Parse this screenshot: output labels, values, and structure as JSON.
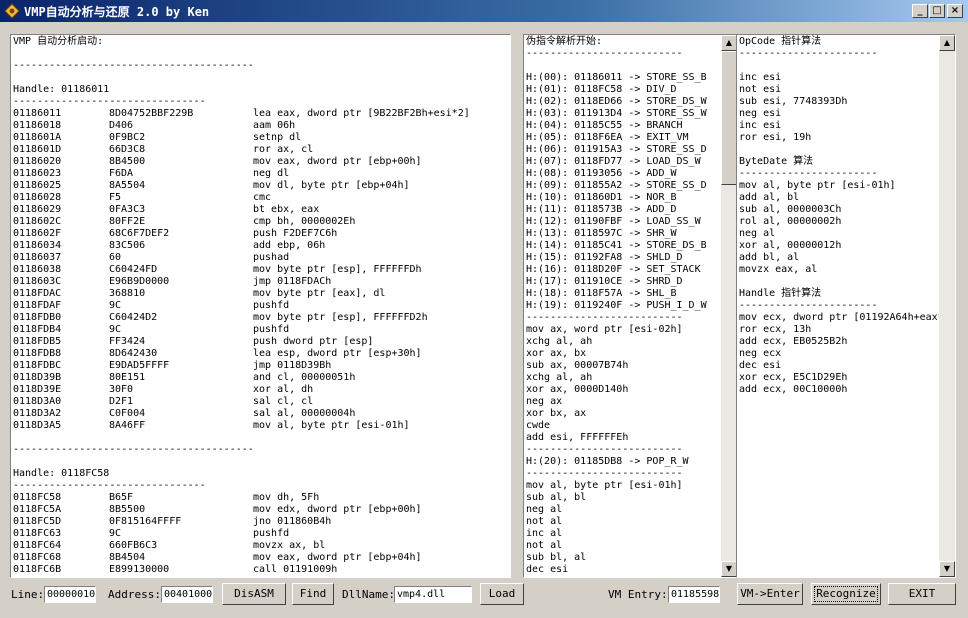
{
  "window": {
    "title": "VMP自动分析与还原 2.0 by Ken",
    "controls": {
      "minimize": "_",
      "maximize": "□",
      "close": "×"
    }
  },
  "left_pane": {
    "lines": [
      [
        "VMP 自动分析启动:"
      ],
      [
        ""
      ],
      [
        "----------------------------------------"
      ],
      [
        ""
      ],
      [
        "Handle: 01186011"
      ],
      [
        "--------------------------------"
      ],
      [
        "01186011",
        "8D04752BBF229B",
        "lea eax, dword ptr [9B22BF2Bh+esi*2]"
      ],
      [
        "01186018",
        "D406",
        "aam 06h"
      ],
      [
        "0118601A",
        "0F9BC2",
        "setnp dl"
      ],
      [
        "0118601D",
        "66D3C8",
        "ror ax, cl"
      ],
      [
        "01186020",
        "8B4500",
        "mov eax, dword ptr [ebp+00h]"
      ],
      [
        "01186023",
        "F6DA",
        "neg dl"
      ],
      [
        "01186025",
        "8A5504",
        "mov dl, byte ptr [ebp+04h]"
      ],
      [
        "01186028",
        "F5",
        "cmc"
      ],
      [
        "01186029",
        "0FA3C3",
        "bt ebx, eax"
      ],
      [
        "0118602C",
        "80FF2E",
        "cmp bh, 0000002Eh"
      ],
      [
        "0118602F",
        "68C6F7DEF2",
        "push F2DEF7C6h"
      ],
      [
        "01186034",
        "83C506",
        "add ebp, 06h"
      ],
      [
        "01186037",
        "60",
        "pushad"
      ],
      [
        "01186038",
        "C60424FD",
        "mov byte ptr [esp], FFFFFFDh"
      ],
      [
        "0118603C",
        "E96B9D0000",
        "jmp 0118FDACh"
      ],
      [
        "0118FDAC",
        "368810",
        "mov byte ptr [eax], dl"
      ],
      [
        "0118FDAF",
        "9C",
        "pushfd"
      ],
      [
        "0118FDB0",
        "C60424D2",
        "mov byte ptr [esp], FFFFFFD2h"
      ],
      [
        "0118FDB4",
        "9C",
        "pushfd"
      ],
      [
        "0118FDB5",
        "FF3424",
        "push dword ptr [esp]"
      ],
      [
        "0118FDB8",
        "8D642430",
        "lea esp, dword ptr [esp+30h]"
      ],
      [
        "0118FDBC",
        "E9DAD5FFFF",
        "jmp 0118D39Bh"
      ],
      [
        "0118D39B",
        "80E151",
        "and cl, 00000051h"
      ],
      [
        "0118D39E",
        "30F0",
        "xor al, dh"
      ],
      [
        "0118D3A0",
        "D2F1",
        "sal cl, cl"
      ],
      [
        "0118D3A2",
        "C0F004",
        "sal al, 00000004h"
      ],
      [
        "0118D3A5",
        "8A46FF",
        "mov al, byte ptr [esi-01h]"
      ],
      [
        ""
      ],
      [
        "----------------------------------------"
      ],
      [
        ""
      ],
      [
        "Handle: 0118FC58"
      ],
      [
        "--------------------------------"
      ],
      [
        "0118FC58",
        "B65F",
        "mov dh, 5Fh"
      ],
      [
        "0118FC5A",
        "8B5500",
        "mov edx, dword ptr [ebp+00h]"
      ],
      [
        "0118FC5D",
        "0F815164FFFF",
        "jno 011860B4h"
      ],
      [
        "0118FC63",
        "9C",
        "pushfd"
      ],
      [
        "0118FC64",
        "660FB6C3",
        "movzx ax, bl"
      ],
      [
        "0118FC68",
        "8B4504",
        "mov eax, dword ptr [ebp+04h]"
      ],
      [
        "0118FC6B",
        "E899130000",
        "call 01191009h"
      ]
    ]
  },
  "mid_pane": {
    "lines": [
      "伪指令解析开始:",
      "--------------------------",
      "",
      "H:(00): 01186011 -> STORE_SS_B",
      "H:(01): 0118FC58 -> DIV_D",
      "H:(02): 0118ED66 -> STORE_DS_W",
      "H:(03): 011913D4 -> STORE_SS_W",
      "H:(04): 01185C55 -> BRANCH",
      "H:(05): 0118F6EA -> EXIT_VM",
      "H:(06): 011915A3 -> STORE_SS_D",
      "H:(07): 0118FD77 -> LOAD_DS_W",
      "H:(08): 01193056 -> ADD_W",
      "H:(09): 011855A2 -> STORE_SS_D",
      "H:(10): 011860D1 -> NOR_B",
      "H:(11): 0118573B -> ADD_D",
      "H:(12): 01190FBF -> LOAD_SS_W",
      "H:(13): 0118597C -> SHR_W",
      "H:(14): 01185C41 -> STORE_DS_B",
      "H:(15): 01192FA8 -> SHLD_D",
      "H:(16): 0118D20F -> SET_STACK",
      "H:(17): 011910CE -> SHRD_D",
      "H:(18): 0118F57A -> SHL_B",
      "H:(19): 0119240F -> PUSH_I_D_W",
      "--------------------------",
      "mov ax, word ptr [esi-02h]",
      "xchg al, ah",
      "xor ax, bx",
      "sub ax, 00007B74h",
      "xchg al, ah",
      "xor ax, 0000D140h",
      "neg ax",
      "xor bx, ax",
      "cwde",
      "add esi, FFFFFFEh",
      "--------------------------",
      "H:(20): 01185DB8 -> POP_R_W",
      "--------------------------",
      "mov al, byte ptr [esi-01h]",
      "sub al, bl",
      "neg al",
      "not al",
      "inc al",
      "not al",
      "sub bl, al",
      "dec esi"
    ]
  },
  "right_pane": {
    "lines": [
      "OpCode 指针算法",
      "-----------------------",
      "",
      "inc esi",
      "not esi",
      "sub esi, 7748393Dh",
      "neg esi",
      "inc esi",
      "ror esi, 19h",
      "",
      "ByteDate 算法",
      "-----------------------",
      "mov al, byte ptr [esi-01h]",
      "add al, bl",
      "sub al, 0000003Ch",
      "rol al, 00000002h",
      "neg al",
      "xor al, 00000012h",
      "add bl, al",
      "movzx eax, al",
      "",
      "Handle 指针算法",
      "-----------------------",
      "mov ecx, dword ptr [01192A64h+eax*",
      "ror ecx, 13h",
      "add ecx, EB0525B2h",
      "neg ecx",
      "dec esi",
      "xor ecx, E5C1D29Eh",
      "add ecx, 00C10000h"
    ]
  },
  "bottom": {
    "line_label": "Line:",
    "line_value": "00000010",
    "address_label": "Address:",
    "address_value": "00401000",
    "disasm_button": "DisASM",
    "find_button": "Find",
    "dllname_label": "DllName:",
    "dllname_value": "vmp4.dll",
    "load_button": "Load",
    "vmentry_label": "VM Entry:",
    "vmentry_value": "01185598",
    "vmenter_button": "VM->Enter",
    "recognize_button": "Recognize",
    "exit_button": "EXIT"
  }
}
